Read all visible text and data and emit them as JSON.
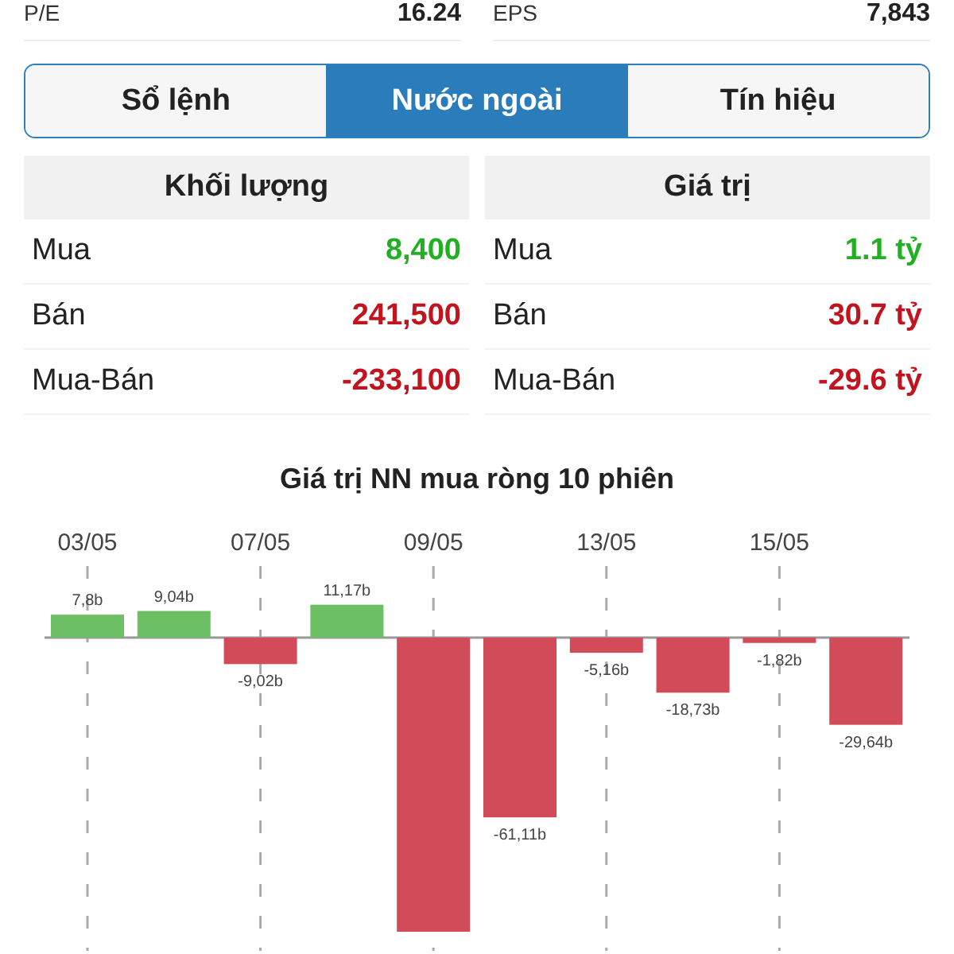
{
  "summary": [
    {
      "label": "P/E",
      "value": "16.24"
    },
    {
      "label": "EPS",
      "value": "7,843"
    }
  ],
  "tabs": [
    {
      "label": "Sổ lệnh",
      "selected": false
    },
    {
      "label": "Nước ngoài",
      "selected": true
    },
    {
      "label": "Tín hiệu",
      "selected": false
    }
  ],
  "panels": [
    {
      "title": "Khối lượng",
      "rows": [
        {
          "label": "Mua",
          "value": "8,400",
          "color": "#22b022"
        },
        {
          "label": "Bán",
          "value": "241,500",
          "color": "#c1141e"
        },
        {
          "label": "Mua-Bán",
          "value": "-233,100",
          "color": "#c1141e"
        }
      ]
    },
    {
      "title": "Giá trị",
      "rows": [
        {
          "label": "Mua",
          "value": "1.1 tỷ",
          "color": "#22b022"
        },
        {
          "label": "Bán",
          "value": "30.7 tỷ",
          "color": "#c1141e"
        },
        {
          "label": "Mua-Bán",
          "value": "-29.6 tỷ",
          "color": "#c1141e"
        }
      ]
    }
  ],
  "chart": {
    "chart_data": {
      "type": "bar",
      "title": "Giá trị NN mua ròng 10 phiên",
      "grid": true,
      "categories": [
        "03/05",
        null,
        "07/05",
        null,
        "09/05",
        null,
        "13/05",
        null,
        "15/05",
        null
      ],
      "values": [
        7.8,
        9.04,
        -9.02,
        11.17,
        -100,
        -61.11,
        -5.16,
        -18.73,
        -1.82,
        -29.64
      ],
      "value_labels": [
        "7,8b",
        "9,04b",
        "-9,02b",
        "11,17b",
        null,
        "-61,11b",
        "-5,16b",
        "-18,73b",
        "-1,82b",
        "-29,64b"
      ]
    }
  }
}
